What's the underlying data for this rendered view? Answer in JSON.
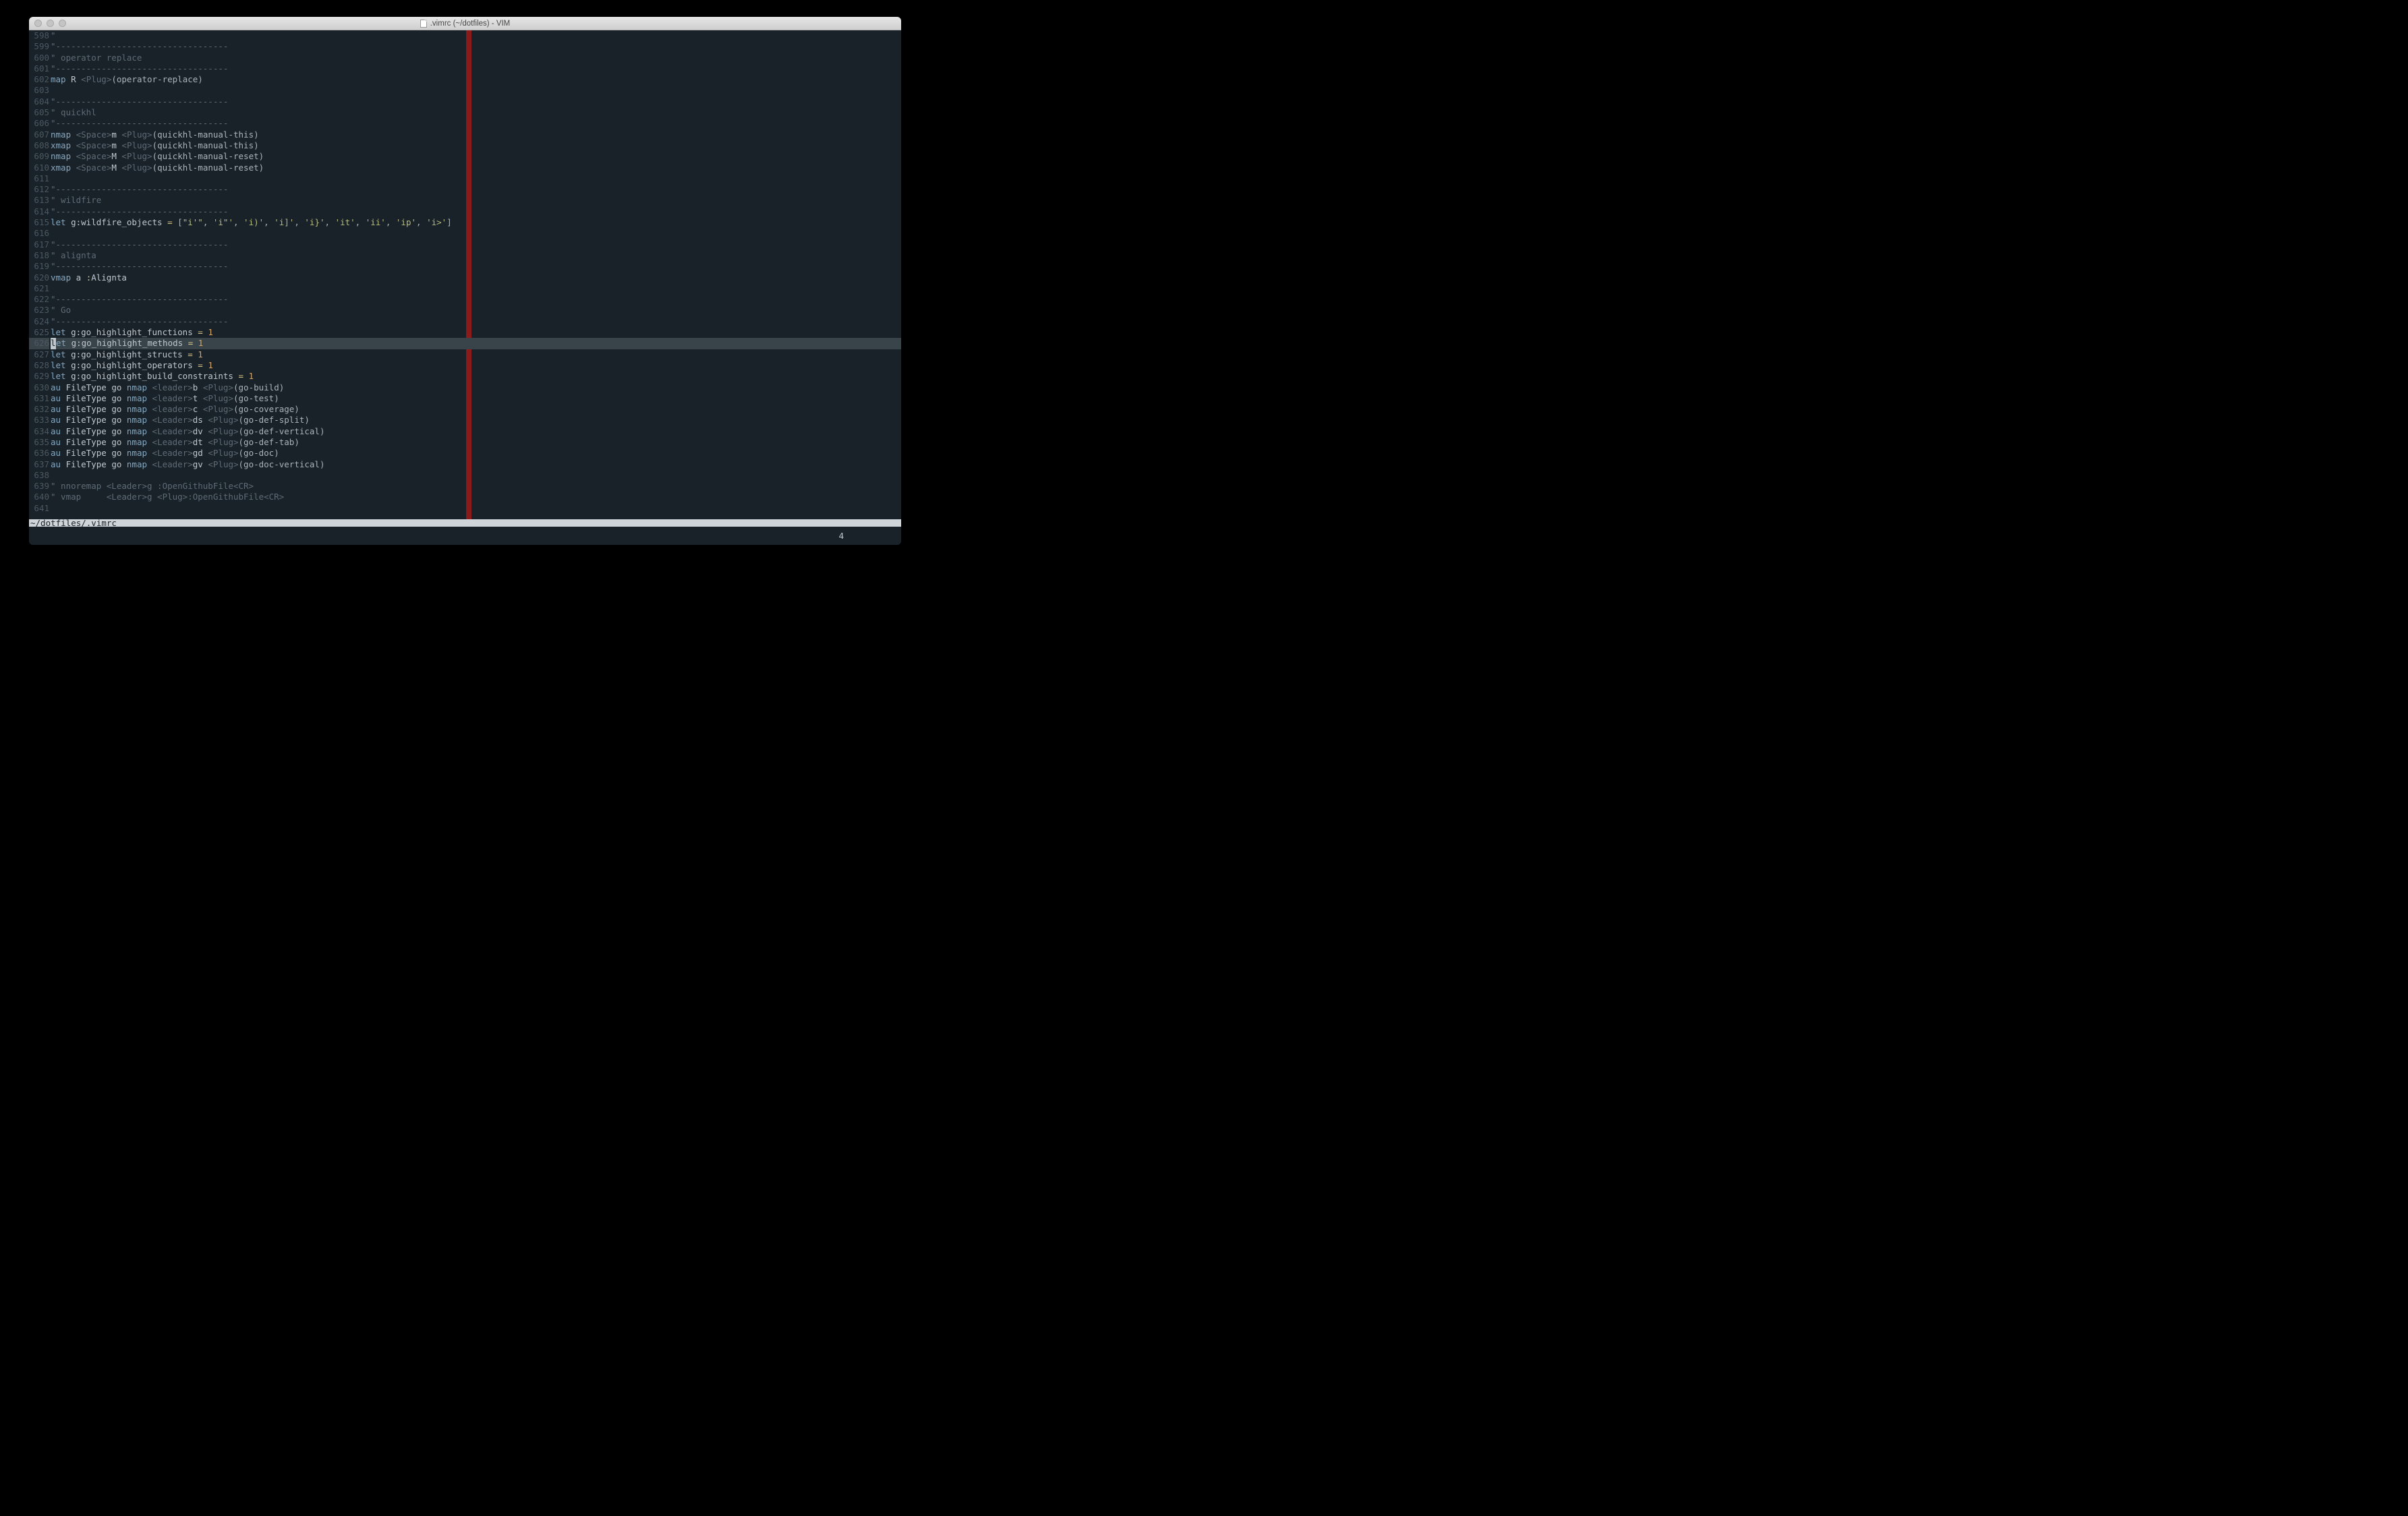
{
  "window": {
    "title": ".vimrc (~/dotfiles) - VIM"
  },
  "editor": {
    "first_line": 598,
    "cursor_line": 626,
    "lines": [
      [
        {
          "t": "\"",
          "c": "s-cm"
        }
      ],
      [
        {
          "t": "\"----------------------------------",
          "c": "s-cm"
        }
      ],
      [
        {
          "t": "\" operator replace",
          "c": "s-cm"
        }
      ],
      [
        {
          "t": "\"----------------------------------",
          "c": "s-cm"
        }
      ],
      [
        {
          "t": "map",
          "c": "s-kw"
        },
        {
          "t": " R",
          "c": "s-id"
        },
        {
          "t": " <",
          "c": "s-angle"
        },
        {
          "t": "Plug",
          "c": "s-angle"
        },
        {
          "t": ">",
          "c": "s-angle"
        },
        {
          "t": "(operator-replace)",
          "c": "s-punc"
        }
      ],
      [],
      [
        {
          "t": "\"----------------------------------",
          "c": "s-cm"
        }
      ],
      [
        {
          "t": "\" quickhl",
          "c": "s-cm"
        }
      ],
      [
        {
          "t": "\"----------------------------------",
          "c": "s-cm"
        }
      ],
      [
        {
          "t": "nmap",
          "c": "s-kw"
        },
        {
          "t": " <",
          "c": "s-angle"
        },
        {
          "t": "Space",
          "c": "s-angle"
        },
        {
          "t": ">",
          "c": "s-angle"
        },
        {
          "t": "m",
          "c": "s-id"
        },
        {
          "t": " <",
          "c": "s-angle"
        },
        {
          "t": "Plug",
          "c": "s-angle"
        },
        {
          "t": ">",
          "c": "s-angle"
        },
        {
          "t": "(quickhl-manual-this)",
          "c": "s-punc"
        }
      ],
      [
        {
          "t": "xmap",
          "c": "s-kw"
        },
        {
          "t": " <",
          "c": "s-angle"
        },
        {
          "t": "Space",
          "c": "s-angle"
        },
        {
          "t": ">",
          "c": "s-angle"
        },
        {
          "t": "m",
          "c": "s-id"
        },
        {
          "t": " <",
          "c": "s-angle"
        },
        {
          "t": "Plug",
          "c": "s-angle"
        },
        {
          "t": ">",
          "c": "s-angle"
        },
        {
          "t": "(quickhl-manual-this)",
          "c": "s-punc"
        }
      ],
      [
        {
          "t": "nmap",
          "c": "s-kw"
        },
        {
          "t": " <",
          "c": "s-angle"
        },
        {
          "t": "Space",
          "c": "s-angle"
        },
        {
          "t": ">",
          "c": "s-angle"
        },
        {
          "t": "M",
          "c": "s-id"
        },
        {
          "t": " <",
          "c": "s-angle"
        },
        {
          "t": "Plug",
          "c": "s-angle"
        },
        {
          "t": ">",
          "c": "s-angle"
        },
        {
          "t": "(quickhl-manual-reset)",
          "c": "s-punc"
        }
      ],
      [
        {
          "t": "xmap",
          "c": "s-kw"
        },
        {
          "t": " <",
          "c": "s-angle"
        },
        {
          "t": "Space",
          "c": "s-angle"
        },
        {
          "t": ">",
          "c": "s-angle"
        },
        {
          "t": "M",
          "c": "s-id"
        },
        {
          "t": " <",
          "c": "s-angle"
        },
        {
          "t": "Plug",
          "c": "s-angle"
        },
        {
          "t": ">",
          "c": "s-angle"
        },
        {
          "t": "(quickhl-manual-reset)",
          "c": "s-punc"
        }
      ],
      [],
      [
        {
          "t": "\"----------------------------------",
          "c": "s-cm"
        }
      ],
      [
        {
          "t": "\" wildfire",
          "c": "s-cm"
        }
      ],
      [
        {
          "t": "\"----------------------------------",
          "c": "s-cm"
        }
      ],
      [
        {
          "t": "let",
          "c": "s-kw"
        },
        {
          "t": " ",
          "c": ""
        },
        {
          "t": "g:wildfire_objects",
          "c": "s-id"
        },
        {
          "t": " =",
          "c": "s-op"
        },
        {
          "t": " [",
          "c": "s-punc"
        },
        {
          "t": "\"i'\"",
          "c": "s-str"
        },
        {
          "t": ", ",
          "c": "s-punc"
        },
        {
          "t": "'i\"'",
          "c": "s-str"
        },
        {
          "t": ", ",
          "c": "s-punc"
        },
        {
          "t": "'i)'",
          "c": "s-str"
        },
        {
          "t": ", ",
          "c": "s-punc"
        },
        {
          "t": "'i]'",
          "c": "s-str"
        },
        {
          "t": ", ",
          "c": "s-punc"
        },
        {
          "t": "'i}'",
          "c": "s-str"
        },
        {
          "t": ", ",
          "c": "s-punc"
        },
        {
          "t": "'it'",
          "c": "s-str"
        },
        {
          "t": ", ",
          "c": "s-punc"
        },
        {
          "t": "'ii'",
          "c": "s-str"
        },
        {
          "t": ", ",
          "c": "s-punc"
        },
        {
          "t": "'ip'",
          "c": "s-str"
        },
        {
          "t": ", ",
          "c": "s-punc"
        },
        {
          "t": "'i>'",
          "c": "s-str"
        },
        {
          "t": "]",
          "c": "s-punc"
        }
      ],
      [],
      [
        {
          "t": "\"----------------------------------",
          "c": "s-cm"
        }
      ],
      [
        {
          "t": "\" alignta",
          "c": "s-cm"
        }
      ],
      [
        {
          "t": "\"----------------------------------",
          "c": "s-cm"
        }
      ],
      [
        {
          "t": "vmap",
          "c": "s-kw"
        },
        {
          "t": " a",
          "c": "s-id"
        },
        {
          "t": " :",
          "c": "s-op"
        },
        {
          "t": "Alignta",
          "c": "s-id"
        }
      ],
      [],
      [
        {
          "t": "\"----------------------------------",
          "c": "s-cm"
        }
      ],
      [
        {
          "t": "\" Go",
          "c": "s-cm"
        }
      ],
      [
        {
          "t": "\"----------------------------------",
          "c": "s-cm"
        }
      ],
      [
        {
          "t": "let",
          "c": "s-kw"
        },
        {
          "t": " ",
          "c": ""
        },
        {
          "t": "g:go_highlight_functions",
          "c": "s-id"
        },
        {
          "t": " =",
          "c": "s-op"
        },
        {
          "t": " ",
          "c": ""
        },
        {
          "t": "1",
          "c": "s-num"
        }
      ],
      [
        {
          "t": "l",
          "c": "s-kw",
          "cursor": true
        },
        {
          "t": "et",
          "c": "s-kw"
        },
        {
          "t": " ",
          "c": ""
        },
        {
          "t": "g:go_highlight_methods",
          "c": "s-id"
        },
        {
          "t": " =",
          "c": "s-op"
        },
        {
          "t": " ",
          "c": ""
        },
        {
          "t": "1",
          "c": "s-num"
        }
      ],
      [
        {
          "t": "let",
          "c": "s-kw"
        },
        {
          "t": " ",
          "c": ""
        },
        {
          "t": "g:go_highlight_structs",
          "c": "s-id"
        },
        {
          "t": " =",
          "c": "s-op"
        },
        {
          "t": " ",
          "c": ""
        },
        {
          "t": "1",
          "c": "s-num"
        }
      ],
      [
        {
          "t": "let",
          "c": "s-kw"
        },
        {
          "t": " ",
          "c": ""
        },
        {
          "t": "g:go_highlight_operators",
          "c": "s-id"
        },
        {
          "t": " =",
          "c": "s-op"
        },
        {
          "t": " ",
          "c": ""
        },
        {
          "t": "1",
          "c": "s-num"
        }
      ],
      [
        {
          "t": "let",
          "c": "s-kw"
        },
        {
          "t": " ",
          "c": ""
        },
        {
          "t": "g:go_highlight_build_constraints",
          "c": "s-id"
        },
        {
          "t": " =",
          "c": "s-op"
        },
        {
          "t": " ",
          "c": ""
        },
        {
          "t": "1",
          "c": "s-num"
        }
      ],
      [
        {
          "t": "au",
          "c": "s-kw"
        },
        {
          "t": " FileType go ",
          "c": "s-id"
        },
        {
          "t": "nmap",
          "c": "s-kw"
        },
        {
          "t": " <",
          "c": "s-angle"
        },
        {
          "t": "leader",
          "c": "s-angle"
        },
        {
          "t": ">",
          "c": "s-angle"
        },
        {
          "t": "b",
          "c": "s-id"
        },
        {
          "t": " <",
          "c": "s-angle"
        },
        {
          "t": "Plug",
          "c": "s-angle"
        },
        {
          "t": ">",
          "c": "s-angle"
        },
        {
          "t": "(go-build)",
          "c": "s-punc"
        }
      ],
      [
        {
          "t": "au",
          "c": "s-kw"
        },
        {
          "t": " FileType go ",
          "c": "s-id"
        },
        {
          "t": "nmap",
          "c": "s-kw"
        },
        {
          "t": " <",
          "c": "s-angle"
        },
        {
          "t": "leader",
          "c": "s-angle"
        },
        {
          "t": ">",
          "c": "s-angle"
        },
        {
          "t": "t",
          "c": "s-id"
        },
        {
          "t": " <",
          "c": "s-angle"
        },
        {
          "t": "Plug",
          "c": "s-angle"
        },
        {
          "t": ">",
          "c": "s-angle"
        },
        {
          "t": "(go-test)",
          "c": "s-punc"
        }
      ],
      [
        {
          "t": "au",
          "c": "s-kw"
        },
        {
          "t": " FileType go ",
          "c": "s-id"
        },
        {
          "t": "nmap",
          "c": "s-kw"
        },
        {
          "t": " <",
          "c": "s-angle"
        },
        {
          "t": "leader",
          "c": "s-angle"
        },
        {
          "t": ">",
          "c": "s-angle"
        },
        {
          "t": "c",
          "c": "s-id"
        },
        {
          "t": " <",
          "c": "s-angle"
        },
        {
          "t": "Plug",
          "c": "s-angle"
        },
        {
          "t": ">",
          "c": "s-angle"
        },
        {
          "t": "(go-coverage)",
          "c": "s-punc"
        }
      ],
      [
        {
          "t": "au",
          "c": "s-kw"
        },
        {
          "t": " FileType go ",
          "c": "s-id"
        },
        {
          "t": "nmap",
          "c": "s-kw"
        },
        {
          "t": " <",
          "c": "s-angle"
        },
        {
          "t": "Leader",
          "c": "s-angle"
        },
        {
          "t": ">",
          "c": "s-angle"
        },
        {
          "t": "ds",
          "c": "s-id"
        },
        {
          "t": " <",
          "c": "s-angle"
        },
        {
          "t": "Plug",
          "c": "s-angle"
        },
        {
          "t": ">",
          "c": "s-angle"
        },
        {
          "t": "(go-def-split)",
          "c": "s-punc"
        }
      ],
      [
        {
          "t": "au",
          "c": "s-kw"
        },
        {
          "t": " FileType go ",
          "c": "s-id"
        },
        {
          "t": "nmap",
          "c": "s-kw"
        },
        {
          "t": " <",
          "c": "s-angle"
        },
        {
          "t": "Leader",
          "c": "s-angle"
        },
        {
          "t": ">",
          "c": "s-angle"
        },
        {
          "t": "dv",
          "c": "s-id"
        },
        {
          "t": " <",
          "c": "s-angle"
        },
        {
          "t": "Plug",
          "c": "s-angle"
        },
        {
          "t": ">",
          "c": "s-angle"
        },
        {
          "t": "(go-def-vertical)",
          "c": "s-punc"
        }
      ],
      [
        {
          "t": "au",
          "c": "s-kw"
        },
        {
          "t": " FileType go ",
          "c": "s-id"
        },
        {
          "t": "nmap",
          "c": "s-kw"
        },
        {
          "t": " <",
          "c": "s-angle"
        },
        {
          "t": "Leader",
          "c": "s-angle"
        },
        {
          "t": ">",
          "c": "s-angle"
        },
        {
          "t": "dt",
          "c": "s-id"
        },
        {
          "t": " <",
          "c": "s-angle"
        },
        {
          "t": "Plug",
          "c": "s-angle"
        },
        {
          "t": ">",
          "c": "s-angle"
        },
        {
          "t": "(go-def-tab)",
          "c": "s-punc"
        }
      ],
      [
        {
          "t": "au",
          "c": "s-kw"
        },
        {
          "t": " FileType go ",
          "c": "s-id"
        },
        {
          "t": "nmap",
          "c": "s-kw"
        },
        {
          "t": " <",
          "c": "s-angle"
        },
        {
          "t": "Leader",
          "c": "s-angle"
        },
        {
          "t": ">",
          "c": "s-angle"
        },
        {
          "t": "gd",
          "c": "s-id"
        },
        {
          "t": " <",
          "c": "s-angle"
        },
        {
          "t": "Plug",
          "c": "s-angle"
        },
        {
          "t": ">",
          "c": "s-angle"
        },
        {
          "t": "(go-doc)",
          "c": "s-punc"
        }
      ],
      [
        {
          "t": "au",
          "c": "s-kw"
        },
        {
          "t": " FileType go ",
          "c": "s-id"
        },
        {
          "t": "nmap",
          "c": "s-kw"
        },
        {
          "t": " <",
          "c": "s-angle"
        },
        {
          "t": "Leader",
          "c": "s-angle"
        },
        {
          "t": ">",
          "c": "s-angle"
        },
        {
          "t": "gv",
          "c": "s-id"
        },
        {
          "t": " <",
          "c": "s-angle"
        },
        {
          "t": "Plug",
          "c": "s-angle"
        },
        {
          "t": ">",
          "c": "s-angle"
        },
        {
          "t": "(go-doc-vertical)",
          "c": "s-punc"
        }
      ],
      [],
      [
        {
          "t": "\" nnoremap <Leader>g :OpenGithubFile<CR>",
          "c": "s-cm"
        }
      ],
      [
        {
          "t": "\" vmap     <Leader>g <Plug>:OpenGithubFile<CR>",
          "c": "s-cm"
        }
      ],
      []
    ]
  },
  "statusbar": {
    "path": "~/dotfiles/.vimrc"
  },
  "bottom": {
    "col": "4"
  }
}
